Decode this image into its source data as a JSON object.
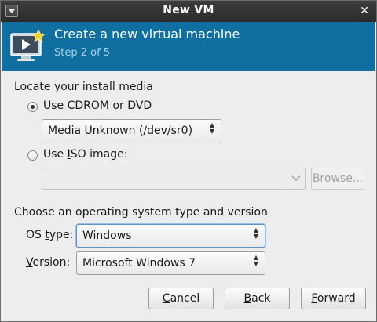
{
  "window": {
    "title": "New VM",
    "close_glyph": "✕"
  },
  "header": {
    "title": "Create a new virtual machine",
    "step": "Step 2 of 5"
  },
  "install_media": {
    "heading": "Locate your install media",
    "cdrom_option": {
      "pre": "Use CD",
      "mnemonic": "R",
      "post": "OM or DVD",
      "checked": true
    },
    "cdrom_selected": "Media Unknown (/dev/sr0)",
    "iso_option": {
      "pre": "Use ",
      "mnemonic": "I",
      "post": "SO image:",
      "checked": false
    },
    "iso_path": "",
    "browse_button": {
      "pre": "Bro",
      "mnemonic": "w",
      "post": "se..."
    }
  },
  "os_section": {
    "heading": "Choose an operating system type and version",
    "os_type_label": {
      "pre": "OS ",
      "mnemonic": "t",
      "post": "ype:"
    },
    "os_type_value": "Windows",
    "version_label": {
      "pre": "",
      "mnemonic": "V",
      "post": "ersion:"
    },
    "version_value": "Microsoft Windows 7"
  },
  "buttons": {
    "cancel": {
      "pre": "",
      "mnemonic": "C",
      "post": "ancel"
    },
    "back": {
      "pre": "",
      "mnemonic": "B",
      "post": "ack"
    },
    "forward": {
      "pre": "",
      "mnemonic": "F",
      "post": "orward"
    }
  },
  "colors": {
    "header_bg": "#0e6fa0",
    "header_step": "#a9d2ea",
    "titlebar_bg": "#333333"
  },
  "icons": [
    "window-menu-icon",
    "close-icon",
    "virtual-machine-icon",
    "combo-arrows-icon",
    "dropdown-arrow-icon"
  ]
}
